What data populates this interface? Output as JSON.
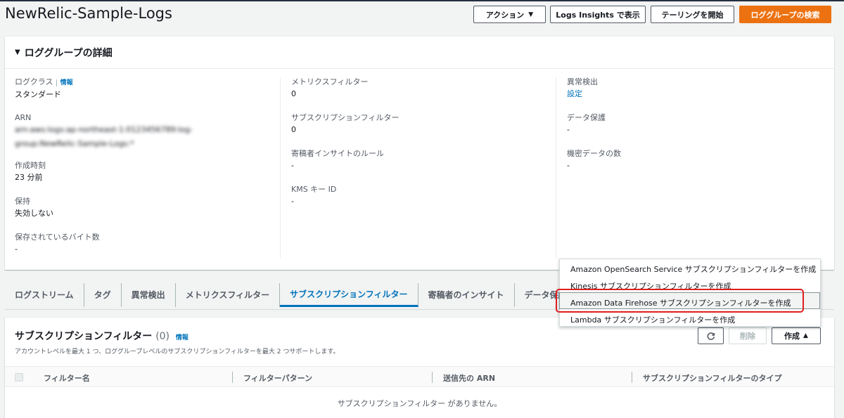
{
  "header": {
    "title": "NewRelic-Sample-Logs",
    "actions_label": "アクション",
    "insights_label": "Logs Insights で表示",
    "tailing_label": "テーリングを開始",
    "search_label": "ロググループの検索"
  },
  "details": {
    "heading": "ロググループの詳細",
    "log_class_label": "ログクラス",
    "info_label": "情報",
    "log_class_value": "スタンダード",
    "arn_label": "ARN",
    "arn_value": "arn:aws:logs:ap-northeast-1:0123456789:log-group:NewRelic-Sample-Logs:*",
    "created_label": "作成時刻",
    "created_value": "23 分前",
    "retention_label": "保持",
    "retention_value": "失効しない",
    "stored_bytes_label": "保存されているバイト数",
    "stored_bytes_value": "-",
    "metric_filter_label": "メトリクスフィルター",
    "metric_filter_value": "0",
    "subscription_filter_label": "サブスクリプションフィルター",
    "subscription_filter_value": "0",
    "contributor_label": "寄稿者インサイトのルール",
    "contributor_value": "-",
    "kms_label": "KMS キー ID",
    "kms_value": "-",
    "anomaly_label": "異常検出",
    "anomaly_value": "設定",
    "data_protection_label": "データ保護",
    "data_protection_value": "-",
    "sensitive_label": "機密データの数",
    "sensitive_value": "-"
  },
  "tabs": [
    {
      "label": "ログストリーム"
    },
    {
      "label": "タグ"
    },
    {
      "label": "異常検出"
    },
    {
      "label": "メトリクスフィルター"
    },
    {
      "label": "サブスクリプションフィルター"
    },
    {
      "label": "寄稿者のインサイト"
    },
    {
      "label": "データ保護"
    }
  ],
  "subscription": {
    "title": "サブスクリプションフィルター",
    "count": "(0)",
    "info": "情報",
    "description": "アカウントレベルを最大 1 つ、ロググループレベルのサブスクリプションフィルターを最大 2 つサポートします。",
    "delete_label": "削除",
    "create_label": "作成",
    "columns": [
      "フィルター名",
      "フィルターパターン",
      "送信先の ARN",
      "サブスクリプションフィルターのタイプ"
    ],
    "empty_message": "サブスクリプションフィルター がありません。"
  },
  "dropdown": {
    "items": [
      "Amazon OpenSearch Service サブスクリプションフィルターを作成",
      "Kinesis サブスクリプションフィルターを作成",
      "Amazon Data Firehose サブスクリプションフィルターを作成",
      "Lambda サブスクリプションフィルターを作成"
    ]
  },
  "colors": {
    "primary": "#ec7211",
    "link": "#0073bb",
    "highlight_border": "#e01e1e"
  }
}
